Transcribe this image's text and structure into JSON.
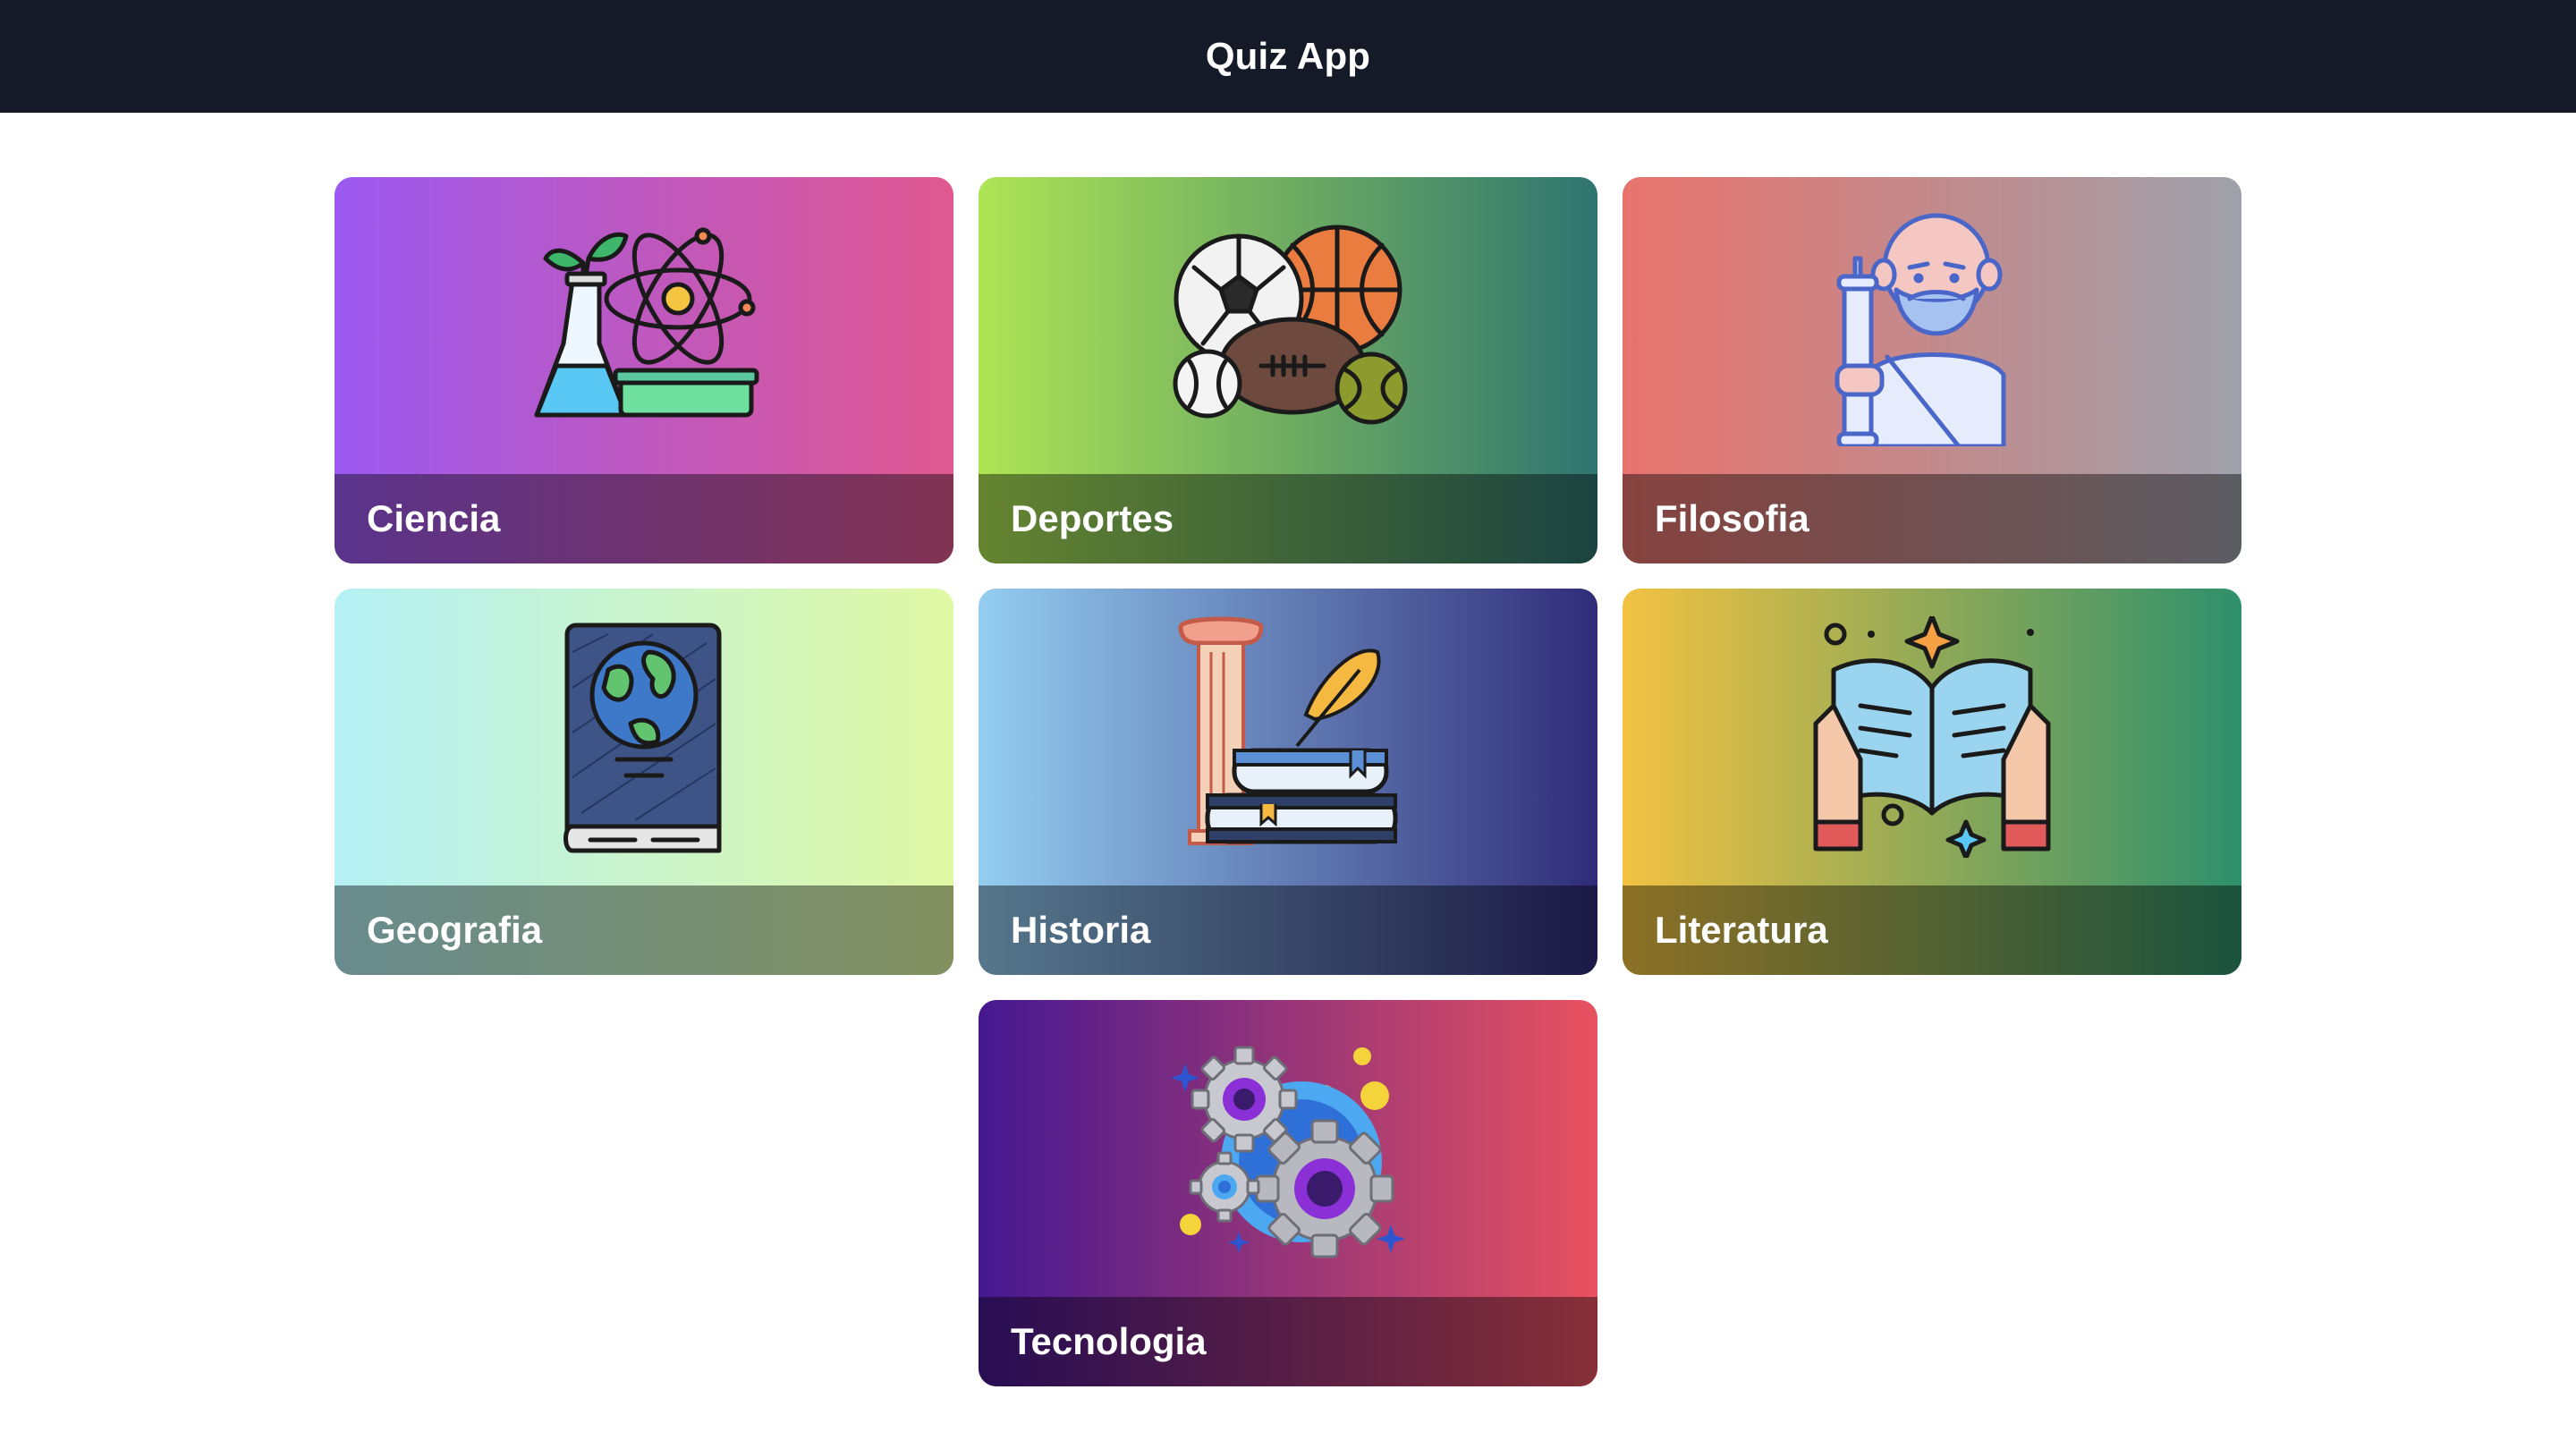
{
  "header": {
    "title": "Quiz App",
    "background": "#141a28"
  },
  "categories": [
    {
      "label": "Ciencia",
      "icon": "science-icon",
      "gradient": [
        "#9b59f0",
        "#e0588f"
      ]
    },
    {
      "label": "Deportes",
      "icon": "sports-balls-icon",
      "gradient": [
        "#aee454",
        "#2f7470"
      ]
    },
    {
      "label": "Filosofia",
      "icon": "philosopher-icon",
      "gradient": [
        "#e8736d",
        "#9ea1ab"
      ]
    },
    {
      "label": "Geografia",
      "icon": "globe-book-icon",
      "gradient": [
        "#b4f0f4",
        "#e0f8a4"
      ]
    },
    {
      "label": "Historia",
      "icon": "history-column-books-icon",
      "gradient": [
        "#94cdf0",
        "#302c78"
      ]
    },
    {
      "label": "Literatura",
      "icon": "open-book-icon",
      "gradient": [
        "#f2c242",
        "#2e906c"
      ]
    },
    {
      "label": "Tecnologia",
      "icon": "gears-icon",
      "gradient": [
        "#451890",
        "#e85260"
      ]
    }
  ]
}
